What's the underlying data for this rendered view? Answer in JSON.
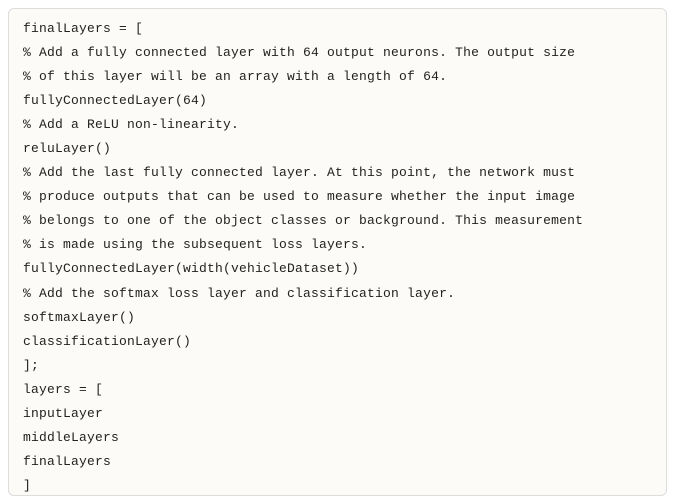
{
  "code": {
    "lines": [
      "finalLayers = [",
      "% Add a fully connected layer with 64 output neurons. The output size",
      "% of this layer will be an array with a length of 64.",
      "fullyConnectedLayer(64)",
      "% Add a ReLU non-linearity.",
      "reluLayer()",
      "% Add the last fully connected layer. At this point, the network must",
      "% produce outputs that can be used to measure whether the input image",
      "% belongs to one of the object classes or background. This measurement",
      "% is made using the subsequent loss layers.",
      "fullyConnectedLayer(width(vehicleDataset))",
      "% Add the softmax loss layer and classification layer.",
      "softmaxLayer()",
      "classificationLayer()",
      "];",
      "",
      "layers = [",
      "inputLayer",
      "middleLayers",
      "finalLayers",
      "]"
    ]
  }
}
